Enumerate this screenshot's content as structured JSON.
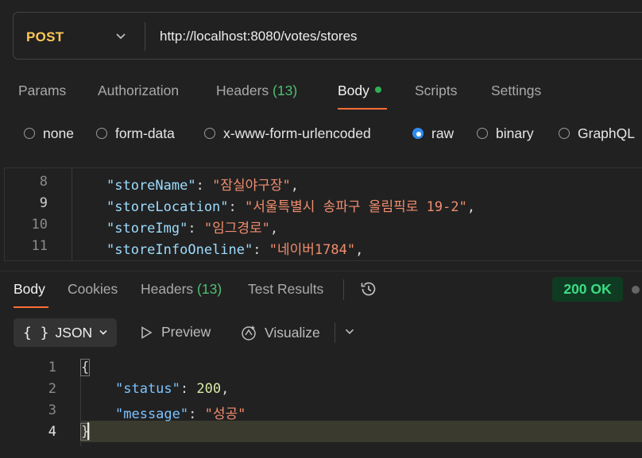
{
  "request": {
    "method": "POST",
    "url": "http://localhost:8080/votes/stores"
  },
  "request_tabs": [
    {
      "label": "Params"
    },
    {
      "label": "Authorization"
    },
    {
      "label": "Headers",
      "count": "(13)"
    },
    {
      "label": "Body"
    },
    {
      "label": "Scripts"
    },
    {
      "label": "Settings"
    }
  ],
  "body_types": [
    {
      "label": "none",
      "selected": false
    },
    {
      "label": "form-data",
      "selected": false
    },
    {
      "label": "x-www-form-urlencoded",
      "selected": false
    },
    {
      "label": "raw",
      "selected": true
    },
    {
      "label": "binary",
      "selected": false
    },
    {
      "label": "GraphQL",
      "selected": false
    }
  ],
  "request_body": {
    "lines": [
      {
        "num": "8",
        "key": "\"storeName\"",
        "value": "\"잠실야구장\""
      },
      {
        "num": "9",
        "key": "\"storeLocation\"",
        "value": "\"서울특별시 송파구 올림픽로 19-2\""
      },
      {
        "num": "10",
        "key": "\"storeImg\"",
        "value": "\"임그경로\""
      },
      {
        "num": "11",
        "key": "\"storeInfoOneline\"",
        "value": "\"네이버1784\""
      }
    ]
  },
  "response_tabs": [
    {
      "label": "Body"
    },
    {
      "label": "Cookies"
    },
    {
      "label": "Headers",
      "count": "(13)"
    },
    {
      "label": "Test Results"
    }
  ],
  "response_status": "200 OK",
  "response_toolbar": {
    "format": "JSON",
    "braces": "{ }",
    "preview": "Preview",
    "visualize": "Visualize"
  },
  "response_body": {
    "line_numbers": [
      "1",
      "2",
      "3",
      "4"
    ],
    "open_brace": "{",
    "close_brace": "}",
    "status_key": "\"status\"",
    "status_value": "200",
    "message_key": "\"message\"",
    "message_value": "\"성공\""
  },
  "colors": {
    "method": "#ffc857",
    "active_underline": "#ff6c37",
    "status_ok": "#3ddc84",
    "radio_selected": "#2d8cf0"
  }
}
